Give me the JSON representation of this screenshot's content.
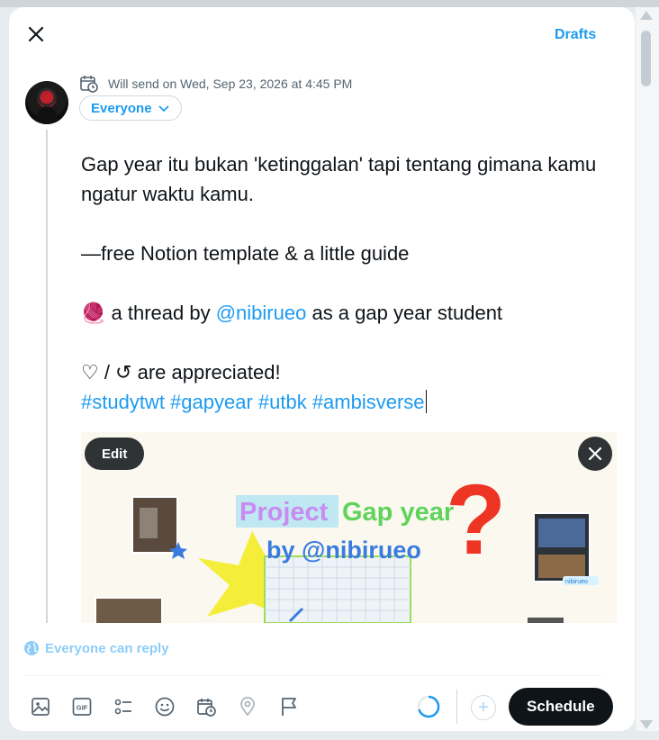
{
  "header": {
    "drafts_label": "Drafts"
  },
  "compose": {
    "schedule_text": "Will send on Wed, Sep 23, 2026 at 4:45 PM",
    "audience_label": "Everyone",
    "text": {
      "line1": "Gap year itu bukan 'ketinggalan' tapi tentang gimana kamu ngatur waktu kamu.",
      "line2": "—free Notion template & a little guide",
      "line3_emoji": "🧶",
      "line3_prefix": " a thread by ",
      "line3_mention": "@nibirueo",
      "line3_suffix": " as a gap year student",
      "line4": "♡ / ↺  are appreciated!",
      "hashtags": "#studytwt #gapyear #utbk #ambisverse"
    },
    "media": {
      "edit_label": "Edit",
      "title_word1": "Project",
      "title_word2": "Gap year",
      "byline": "by @nibirueo",
      "sticker_text": "nibirueo"
    },
    "reply_setting": "Everyone can reply"
  },
  "toolbar": {
    "icons": [
      "image-icon",
      "gif-icon",
      "poll-icon",
      "emoji-icon",
      "schedule-icon",
      "location-icon",
      "flag-icon"
    ],
    "gif_text": "GIF",
    "add_label": "+",
    "schedule_label": "Schedule"
  },
  "colors": {
    "accent": "#1d9bf0",
    "dark": "#0f1419",
    "muted": "#536471"
  }
}
